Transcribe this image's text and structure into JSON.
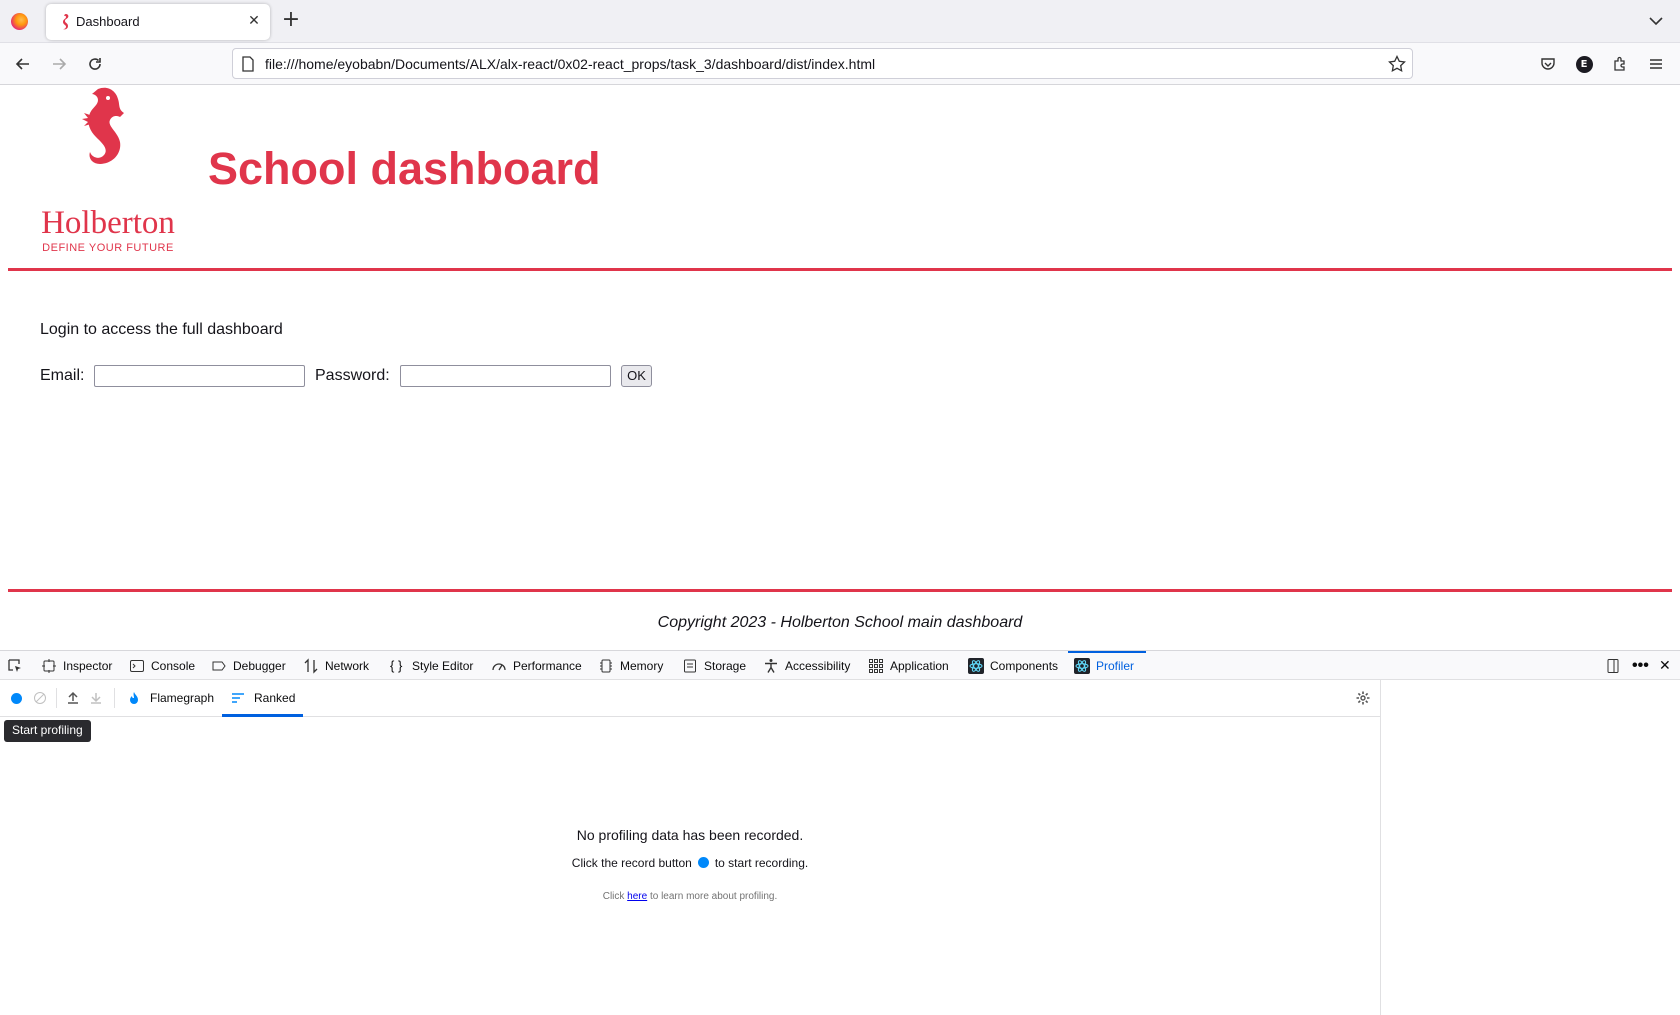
{
  "browser": {
    "tab_title": "Dashboard",
    "url": "file:///home/eyobabn/Documents/ALX/alx-react/0x02-react_props/task_3/dashboard/dist/index.html",
    "account_initial": "E"
  },
  "app": {
    "logo_name": "Holberton",
    "logo_tagline": "DEFINE YOUR FUTURE",
    "title": "School dashboard",
    "login_message": "Login to access the full dashboard",
    "email_label": "Email:",
    "password_label": "Password:",
    "email_value": "",
    "password_value": "",
    "ok_label": "OK",
    "footer": "Copyright 2023 - Holberton School main dashboard",
    "accent_color": "#e0354b"
  },
  "devtools": {
    "tabs": [
      "Inspector",
      "Console",
      "Debugger",
      "Network",
      "Style Editor",
      "Performance",
      "Memory",
      "Storage",
      "Accessibility",
      "Application",
      "Components",
      "Profiler"
    ],
    "active_tab": "Profiler",
    "profiler": {
      "flamegraph_label": "Flamegraph",
      "ranked_label": "Ranked",
      "tooltip": "Start profiling",
      "empty_title": "No profiling data has been recorded.",
      "hint_before": "Click the record button",
      "hint_after": "to start recording.",
      "learn_before": "Click",
      "learn_link": "here",
      "learn_after": "to learn more about profiling."
    }
  }
}
